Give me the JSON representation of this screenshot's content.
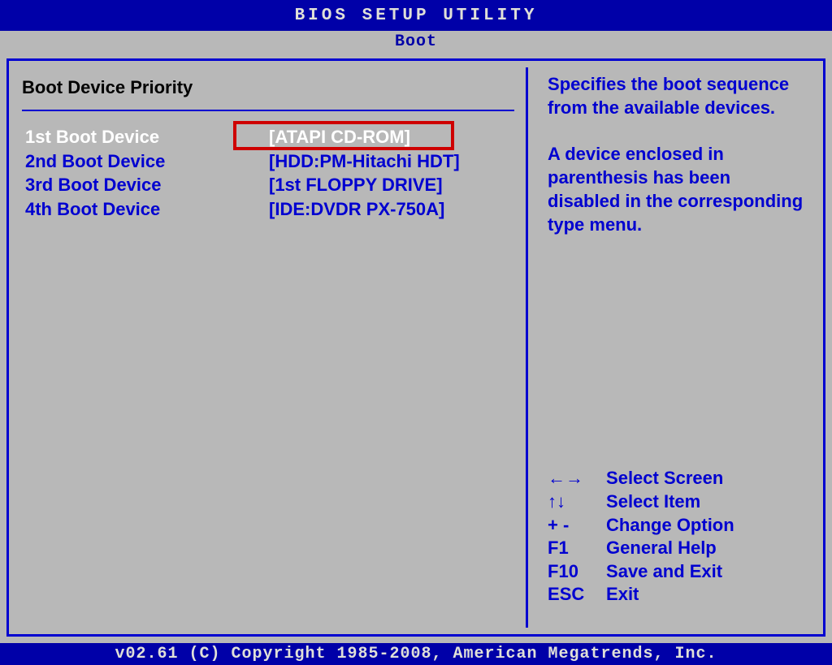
{
  "header": {
    "title": "BIOS SETUP UTILITY"
  },
  "tab": {
    "label": "Boot"
  },
  "section": {
    "title": "Boot Device Priority"
  },
  "devices": [
    {
      "label": "1st Boot Device",
      "value": "[ATAPI CD-ROM]",
      "selected": true
    },
    {
      "label": "2nd Boot Device",
      "value": "[HDD:PM-Hitachi HDT]",
      "selected": false
    },
    {
      "label": "3rd Boot Device",
      "value": "[1st FLOPPY DRIVE]",
      "selected": false
    },
    {
      "label": "4th Boot Device",
      "value": "[IDE:DVDR PX-750A]",
      "selected": false
    }
  ],
  "help": {
    "para1": "Specifies the boot sequence from the available devices.",
    "para2": "A device enclosed in parenthesis has been disabled in the corresponding type menu."
  },
  "keys": [
    {
      "sym": "←→",
      "desc": "Select Screen"
    },
    {
      "sym": "↑↓",
      "desc": "Select Item"
    },
    {
      "sym": "+ -",
      "desc": "Change Option"
    },
    {
      "sym": "F1",
      "desc": "General Help"
    },
    {
      "sym": "F10",
      "desc": "Save and Exit"
    },
    {
      "sym": "ESC",
      "desc": "Exit"
    }
  ],
  "footer": {
    "text": "v02.61 (C) Copyright 1985-2008, American Megatrends, Inc."
  }
}
